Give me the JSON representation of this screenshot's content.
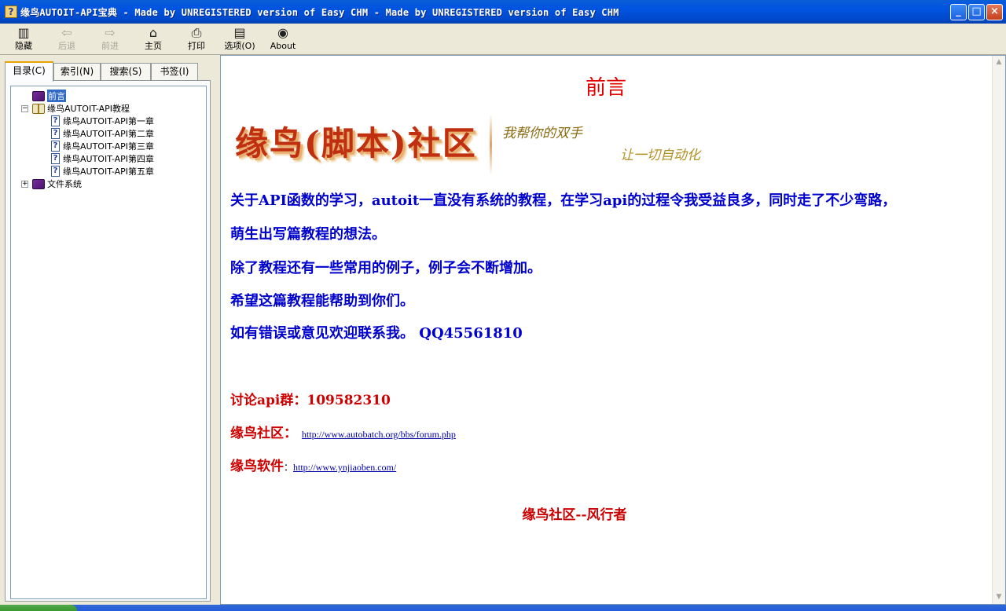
{
  "window": {
    "icon_glyph": "?",
    "title": "缘鸟AUTOIT-API宝典 - Made by UNREGISTERED version of Easy CHM - Made by UNREGISTERED version of Easy CHM",
    "buttons": {
      "minimize": "_",
      "maximize": "□",
      "close": "×"
    }
  },
  "toolbar": {
    "items": [
      {
        "label": "隐藏",
        "icon": "hide-icon",
        "enabled": true
      },
      {
        "label": "后退",
        "icon": "back-arrow-icon",
        "enabled": false
      },
      {
        "label": "前进",
        "icon": "forward-arrow-icon",
        "enabled": false
      },
      {
        "label": "主页",
        "icon": "home-icon",
        "enabled": true
      },
      {
        "label": "打印",
        "icon": "printer-icon",
        "enabled": true
      },
      {
        "label": "选项(O)",
        "icon": "options-icon",
        "enabled": true
      },
      {
        "label": "About",
        "icon": "about-icon",
        "enabled": true
      }
    ],
    "glyphs": [
      "▥",
      "⇦",
      "⇨",
      "⌂",
      "⎙",
      "▤",
      "◉"
    ]
  },
  "nav_tabs": [
    {
      "label": "目录(C)",
      "active": true
    },
    {
      "label": "索引(N)",
      "active": false
    },
    {
      "label": "搜索(S)",
      "active": false
    },
    {
      "label": "书签(I)",
      "active": false
    }
  ],
  "tree": {
    "expanders": {
      "collapse": "−",
      "expand": "+"
    },
    "page_glyph": "?",
    "items": [
      {
        "label": "前言",
        "selected": true
      },
      {
        "label": "缘鸟AUTOIT-API教程",
        "expanded": true
      },
      {
        "label": "缘鸟AUTOIT-API第一章"
      },
      {
        "label": "缘鸟AUTOIT-API第二章"
      },
      {
        "label": "缘鸟AUTOIT-API第三章"
      },
      {
        "label": "缘鸟AUTOIT-API第四章"
      },
      {
        "label": "缘鸟AUTOIT-API第五章"
      },
      {
        "label": "文件系统",
        "expanded": false
      }
    ]
  },
  "content": {
    "heading": "前言",
    "banner": {
      "main": "缘鸟(脚本)社区",
      "tagline_1": "我帮你的双手",
      "tagline_2": "让一切自动化"
    },
    "paragraphs": [
      "关于API函数的学习，autoit一直没有系统的教程，在学习api的过程令我受益良多，同时走了不少弯路，",
      "萌生出写篇教程的想法。",
      "除了教程还有一些常用的例子，例子会不断增加。",
      "希望这篇教程能帮助到你们。",
      "如有错误或意见欢迎联系我。  QQ45561810"
    ],
    "group_label": "讨论api群：",
    "group_number": "109582310",
    "community_label": "缘鸟社区：",
    "community_url": "http://www.autobatch.org/bbs/forum.php",
    "software_label": "缘鸟软件",
    "software_sep": "：",
    "software_url": "http://www.ynjiaoben.com/",
    "signature": "缘鸟社区--风行者"
  },
  "scrollbar": {
    "up": "▲",
    "down": "▼"
  }
}
